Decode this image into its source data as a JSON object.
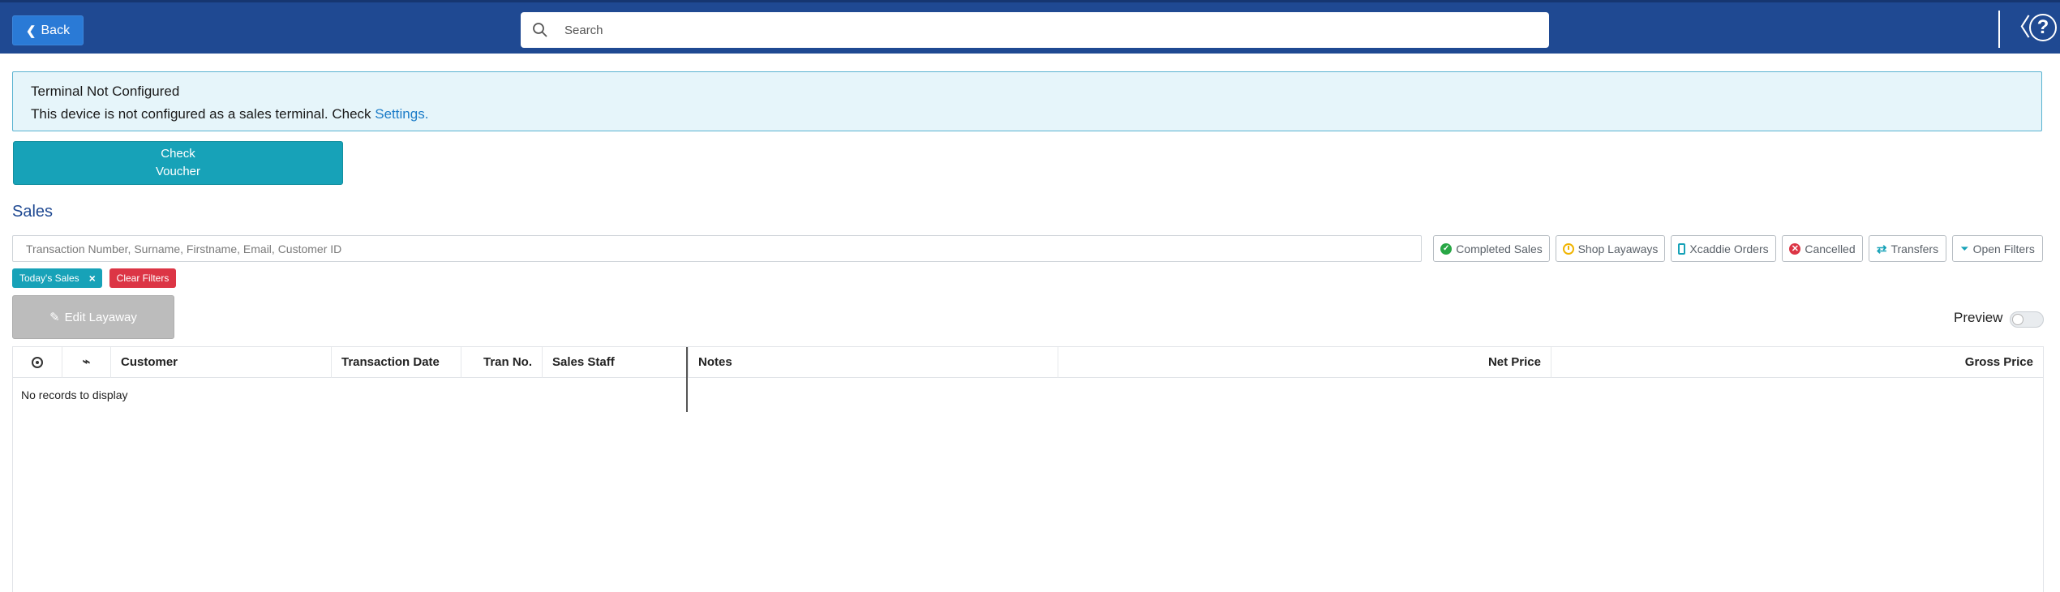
{
  "header": {
    "back_label": "Back",
    "search_placeholder": "Search",
    "collapse_glyph": "〈",
    "help_glyph": "?"
  },
  "alert": {
    "title": "Terminal Not Configured",
    "message": "This device is not configured as a sales terminal. Check ",
    "link": "Settings."
  },
  "voucher_button": {
    "line1": "Check",
    "line2": "Voucher"
  },
  "sales": {
    "title": "Sales",
    "filter_placeholder": "Transaction Number, Surname, Firstname, Email, Customer ID",
    "filters": [
      {
        "label": "Completed Sales",
        "icon": "check-circle-icon"
      },
      {
        "label": "Shop Layaways",
        "icon": "clock-icon"
      },
      {
        "label": "Xcaddie Orders",
        "icon": "mobile-icon"
      },
      {
        "label": "Cancelled",
        "icon": "x-circle-icon"
      },
      {
        "label": "Transfers",
        "icon": "exchange-icon"
      },
      {
        "label": "Open Filters",
        "icon": "funnel-icon"
      }
    ],
    "active_tags": {
      "today": "Today's Sales",
      "clear": "Clear Filters"
    },
    "edit_layaway": "Edit Layaway",
    "preview_label": "Preview",
    "preview_enabled": false
  },
  "grid": {
    "columns": [
      "Customer",
      "Transaction Date",
      "Tran No.",
      "Sales Staff",
      "Notes",
      "Net Price",
      "Gross Price"
    ],
    "empty_message": "No records to display"
  }
}
